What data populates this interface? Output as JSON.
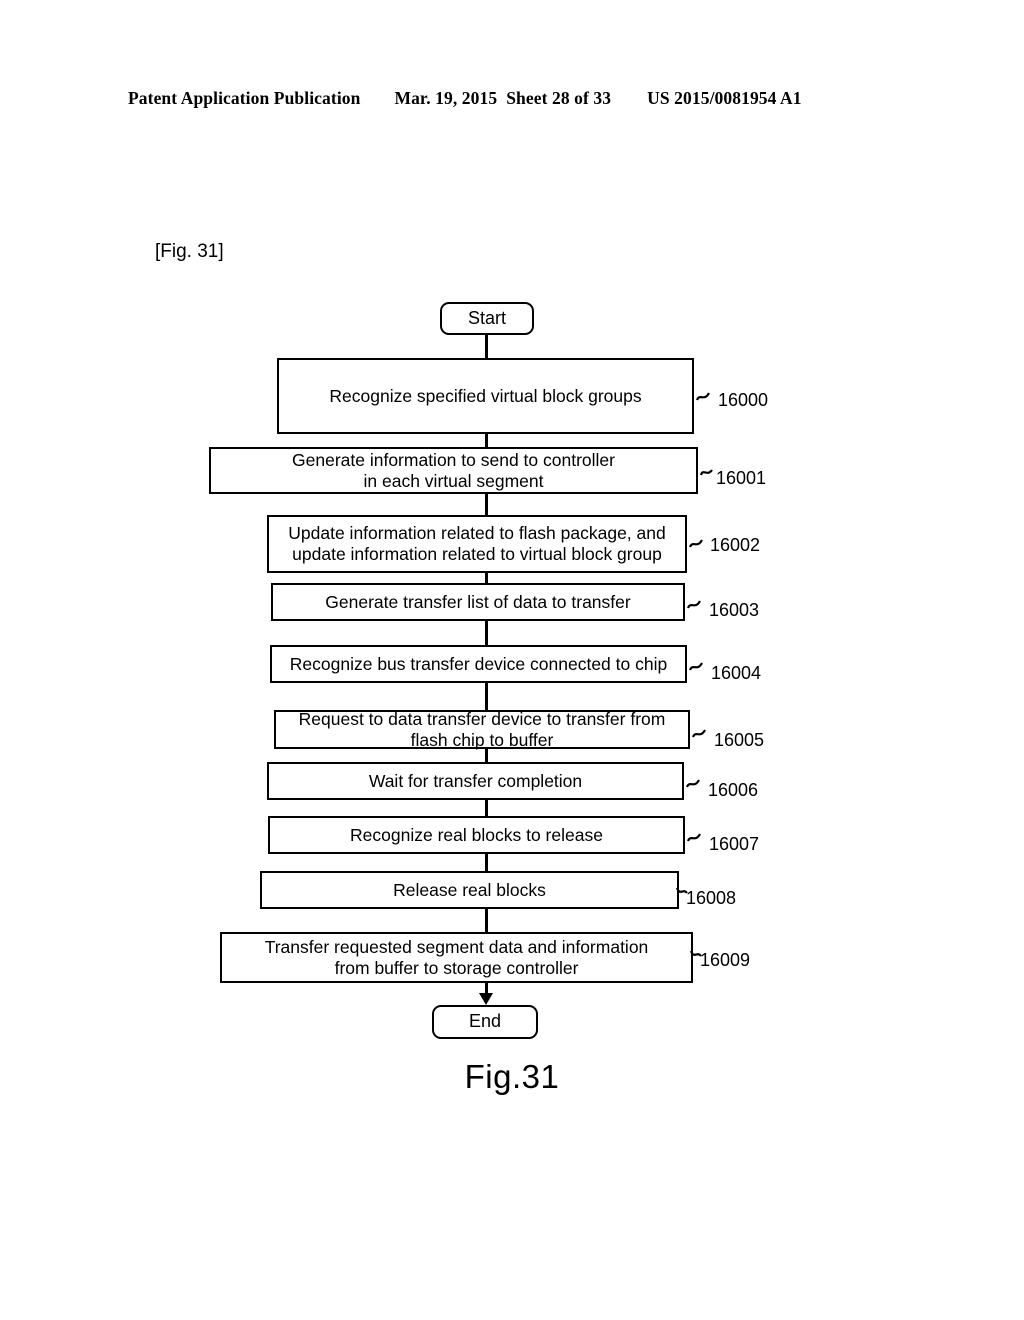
{
  "header": {
    "publication": "Patent Application Publication",
    "date": "Mar. 19, 2015",
    "sheet": "Sheet 28 of 33",
    "patent_number": "US 2015/0081954 A1"
  },
  "figure": {
    "bracket_label": "[Fig. 31]",
    "caption": "Fig.31"
  },
  "flowchart": {
    "type": "flowchart",
    "orientation": "vertical",
    "start": {
      "label": "Start"
    },
    "end": {
      "label": "End"
    },
    "steps": [
      {
        "ref": "16000",
        "text": "Recognize specified virtual block groups"
      },
      {
        "ref": "16001",
        "line1": "Generate information to send to controller",
        "line2": "in each virtual segment"
      },
      {
        "ref": "16002",
        "line1": "Update information related to flash package, and",
        "line2": "update information related to virtual block group"
      },
      {
        "ref": "16003",
        "text": "Generate transfer list of data to transfer"
      },
      {
        "ref": "16004",
        "text": "Recognize bus transfer device connected to chip"
      },
      {
        "ref": "16005",
        "line1": "Request to data transfer device to transfer from",
        "line2": "flash chip to buffer"
      },
      {
        "ref": "16006",
        "text": "Wait for transfer completion"
      },
      {
        "ref": "16007",
        "text": "Recognize real blocks to release"
      },
      {
        "ref": "16008",
        "text": "Release real blocks"
      },
      {
        "ref": "16009",
        "line1": "Transfer requested segment data and information",
        "line2": "from buffer to storage controller"
      }
    ]
  },
  "colors": {
    "ink": "#000000",
    "paper": "#ffffff"
  }
}
